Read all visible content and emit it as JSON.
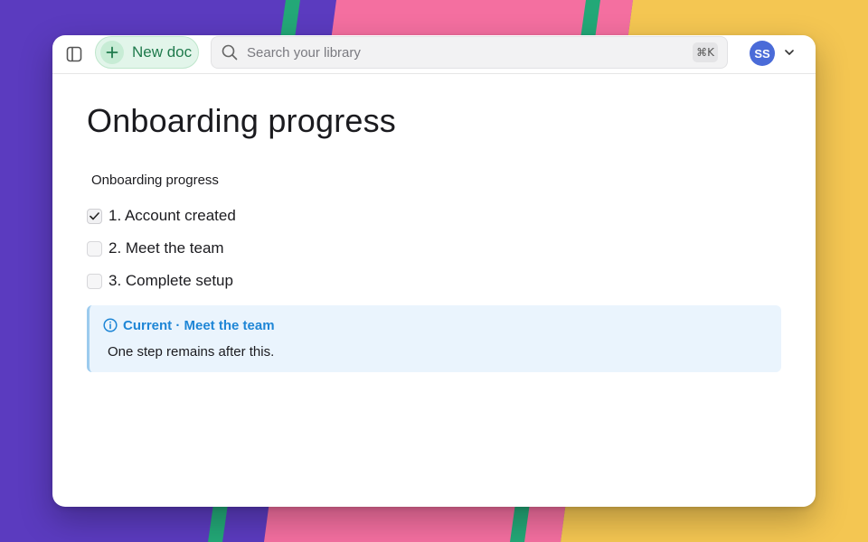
{
  "colors": {
    "bg_purple": "#5b3bbf",
    "bg_pink": "#f46fa0",
    "bg_green": "#23a877",
    "bg_yellow": "#f4c652",
    "accent_green": "#1f7a4c",
    "avatar": "#4a6bd8",
    "callout_bg": "#eaf4fd",
    "callout_accent": "#1f86d6"
  },
  "toolbar": {
    "sidebar_icon": "sidebar-toggle-icon",
    "new_doc_label": "New doc",
    "new_doc_icon": "plus-icon",
    "search_placeholder": "Search your library",
    "search_icon": "search-icon",
    "search_shortcut": "⌘K",
    "avatar_initials": "SS",
    "avatar_menu_icon": "chevron-down-icon"
  },
  "document": {
    "title": "Onboarding progress",
    "section_label": "Onboarding progress",
    "checklist": [
      {
        "label": "1. Account created",
        "checked": true
      },
      {
        "label": "2. Meet the team",
        "checked": false
      },
      {
        "label": "3. Complete setup",
        "checked": false
      }
    ],
    "callout": {
      "icon": "info-icon",
      "title": "Current · Meet the team",
      "body": "One step remains after this."
    }
  }
}
